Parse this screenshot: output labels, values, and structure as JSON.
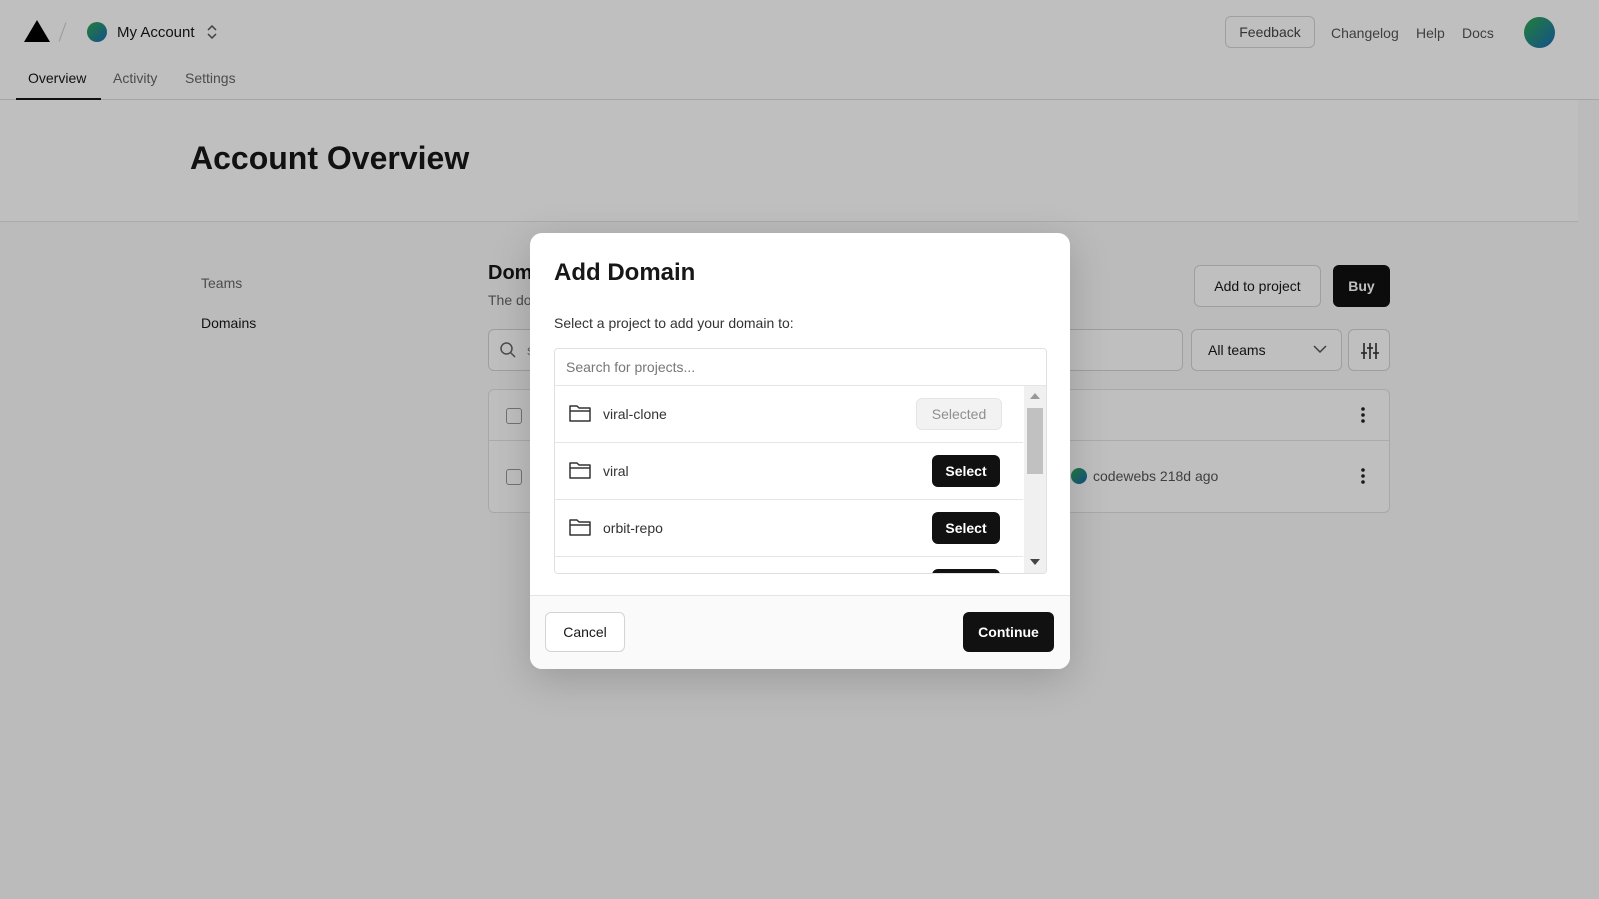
{
  "header": {
    "account_name": "My Account",
    "feedback_label": "Feedback",
    "links": [
      "Changelog",
      "Help",
      "Docs"
    ]
  },
  "tabs": [
    {
      "label": "Overview",
      "active": true
    },
    {
      "label": "Activity",
      "active": false
    },
    {
      "label": "Settings",
      "active": false
    }
  ],
  "page": {
    "title": "Account Overview",
    "sidebar": [
      "Teams",
      "Domains"
    ],
    "section_title_visible": "Dom",
    "section_desc_visible": "The do",
    "add_to_project_label": "Add to project",
    "buy_label": "Buy",
    "search_visible": "s",
    "team_filter": "All teams",
    "row_meta": "codewebs 218d ago"
  },
  "modal": {
    "title": "Add Domain",
    "description": "Select a project to add your domain to:",
    "search_placeholder": "Search for projects...",
    "projects": [
      {
        "name": "viral-clone",
        "action": "Selected"
      },
      {
        "name": "viral",
        "action": "Select"
      },
      {
        "name": "orbit-repo",
        "action": "Select"
      }
    ],
    "cancel_label": "Cancel",
    "continue_label": "Continue"
  },
  "colors": {
    "primary_button": "#111111",
    "overlay": "rgba(0,0,0,0.25)",
    "avatar_gradient_start": "#2fa84f",
    "avatar_gradient_end": "#1b6bb8"
  },
  "icons": [
    "logo-triangle-icon",
    "chevron-updown-icon",
    "search-icon",
    "chevron-down-icon",
    "sliders-icon",
    "kebab-icon",
    "folder-icon",
    "scroll-up-arrow-icon",
    "scroll-down-arrow-icon"
  ]
}
